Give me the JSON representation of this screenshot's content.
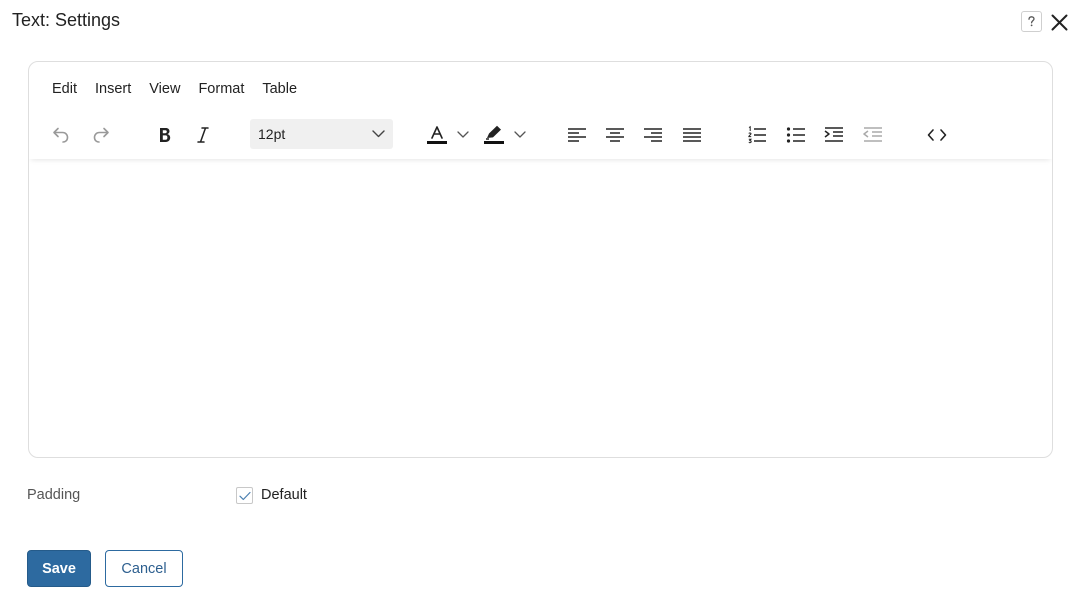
{
  "dialog": {
    "title": "Text: Settings",
    "help_icon": "help-icon",
    "close_icon": "close-icon"
  },
  "editor": {
    "menu": [
      "Edit",
      "Insert",
      "View",
      "Format",
      "Table"
    ],
    "toolbar": {
      "font_size": "12pt",
      "buttons": [
        "undo-icon",
        "redo-icon",
        "bold-icon",
        "italic-icon",
        "text-color-icon",
        "highlight-color-icon",
        "align-left-icon",
        "align-center-icon",
        "align-right-icon",
        "align-justify-icon",
        "numbered-list-icon",
        "bullet-list-icon",
        "indent-icon",
        "outdent-icon",
        "source-code-icon"
      ],
      "text_color": "#111111",
      "highlight_color": "#111111"
    },
    "content": ""
  },
  "padding": {
    "label": "Padding",
    "checkbox_label": "Default",
    "checked": true
  },
  "actions": {
    "save_label": "Save",
    "cancel_label": "Cancel"
  },
  "colors": {
    "primary": "#2d6aa0",
    "border": "#dedede"
  }
}
